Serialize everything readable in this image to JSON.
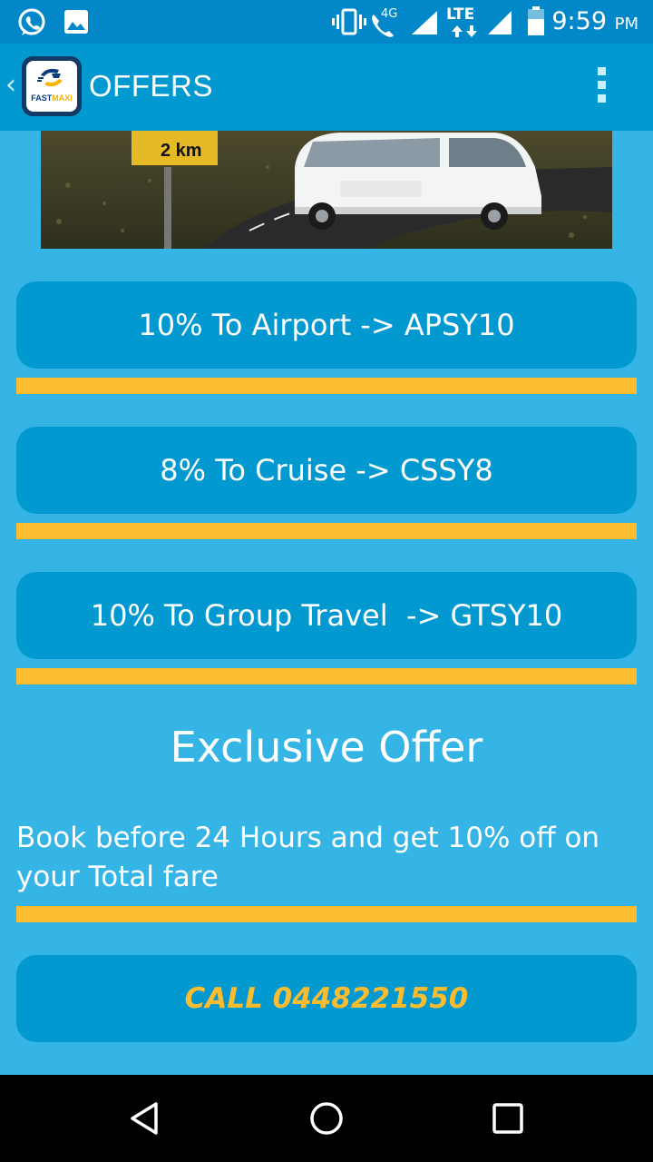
{
  "status_bar": {
    "time": "9:59",
    "ampm": "PM",
    "network_label": "LTE",
    "call_network_label": "4G",
    "icons": [
      "whatsapp-icon",
      "image-icon",
      "vibrate-icon",
      "wifi-calling-icon",
      "signal-icon",
      "lte-data-icon",
      "signal-icon",
      "battery-icon"
    ]
  },
  "app_bar": {
    "title": "OFFERS",
    "logo_text_a": "FAST",
    "logo_text_b": "MAXI",
    "icons": [
      "back-chevron-icon",
      "app-logo",
      "overflow-menu-icon"
    ]
  },
  "offers": [
    {
      "label": "10% To Airport -> APSY10"
    },
    {
      "label": "8% To Cruise -> CSSY8"
    },
    {
      "label": "10% To Group Travel  -> GTSY10"
    }
  ],
  "exclusive": {
    "title": "Exclusive Offer",
    "description": "Book before 24 Hours and get 10% off on your Total fare"
  },
  "call": {
    "label": "CALL 0448221550"
  },
  "colors": {
    "status_bar": "#0288c9",
    "app_bar": "#0299d1",
    "background": "#35b4e6",
    "button": "#0299d1",
    "divider": "#fbbd2f",
    "call_text": "#fbbd2f"
  }
}
